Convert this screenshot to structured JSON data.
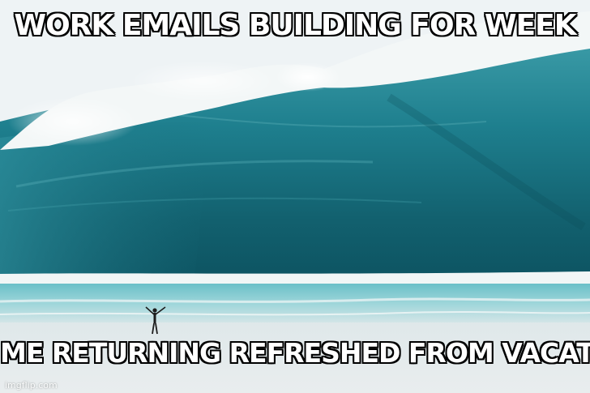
{
  "meme": {
    "top_text": "WORK EMAILS BUILDING FOR WEEK",
    "bottom_text": "ME RETURNING REFRESHED FROM VACATION",
    "watermark": "imgflip.com"
  },
  "colors": {
    "sky": "#eef3f5",
    "wave_dark": "#0f5e6c",
    "wave_mid": "#1e8290",
    "wave_light": "#4fb0ba",
    "foam": "#f4f8f8",
    "shore_water": "#5fb8c2",
    "sand": "#e4eaec"
  },
  "scene": {
    "background_icon": "giant-wave-scene",
    "person_icon": "person-arms-raised-icon"
  }
}
